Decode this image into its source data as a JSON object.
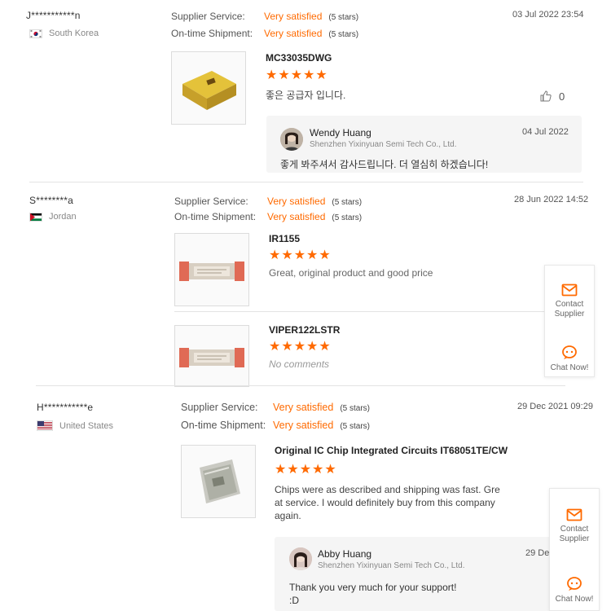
{
  "labels": {
    "supplier_service": "Supplier Service:",
    "ontime_shipment": "On-time Shipment:",
    "rating_value": "Very satisfied",
    "rating_stars": "(5 stars)"
  },
  "reviews": [
    {
      "user": "J***********n",
      "country": "South Korea",
      "date": "03 Jul 2022 23:54",
      "products": [
        {
          "name": "MC33035DWG",
          "stars": "★★★★★",
          "comment": "좋은 공급자 입니다."
        }
      ],
      "likes": "0",
      "reply": {
        "name": "Wendy Huang",
        "company": "Shenzhen Yixinyuan Semi Tech Co., Ltd.",
        "date": "04 Jul 2022",
        "text": "좋게 봐주셔서 감사드립니다. 더 열심히 하겠습니다!"
      }
    },
    {
      "user": "S********a",
      "country": "Jordan",
      "date": "28 Jun 2022 14:52",
      "products": [
        {
          "name": "IR1155",
          "stars": "★★★★★",
          "comment": "Great, original product and good price"
        },
        {
          "name": "VIPER122LSTR",
          "stars": "★★★★★",
          "comment": "No comments"
        }
      ]
    },
    {
      "user": "H***********e",
      "country": "United States",
      "date": "29 Dec 2021 09:29",
      "products": [
        {
          "name": "Original IC Chip Integrated Circuits IT68051TE/CW",
          "stars": "★★★★★",
          "comment": "Chips were as described and shipping was fast. Gre at service. I would definitely buy from this company again."
        }
      ],
      "reply": {
        "name": "Abby Huang",
        "company": "Shenzhen Yixinyuan Semi Tech Co., Ltd.",
        "date": "29 Dec",
        "text": "Thank you very much for your support! :D"
      }
    }
  ],
  "float_widget": {
    "contact_label": "Contact Supplier",
    "chat_label": "Chat Now!"
  },
  "colors": {
    "accent": "#ff6a00",
    "reply_bg": "#f5f5f5"
  }
}
